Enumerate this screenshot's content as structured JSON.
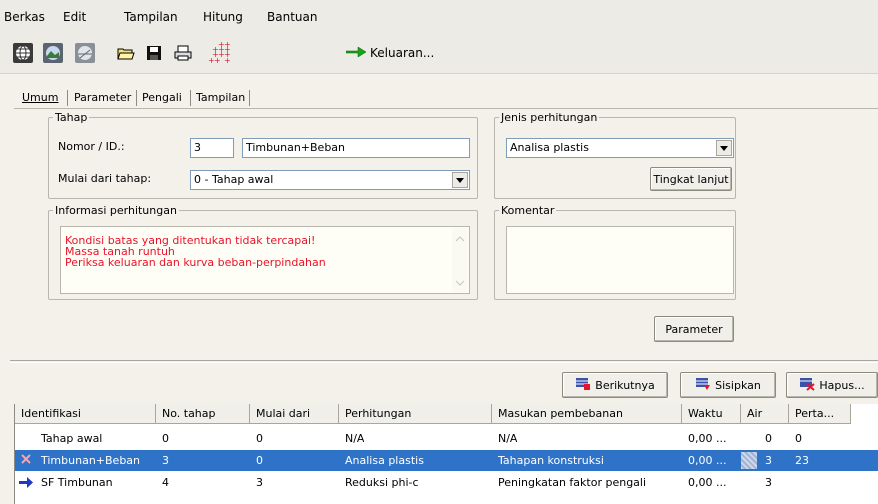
{
  "menu": [
    "Berkas",
    "Edit",
    "Tampilan",
    "Hitung",
    "Bantuan"
  ],
  "toolbar": {
    "icons": [
      "globe-icon",
      "globe-picture-icon",
      "globe-mesh-icon",
      "open-folder-icon",
      "save-icon",
      "print-icon",
      "select-points-icon"
    ],
    "output_label": "Keluaran..."
  },
  "tabs": [
    "Umum",
    "Parameter",
    "Pengali",
    "Tampilan"
  ],
  "tahap": {
    "legend": "Tahap",
    "nomor_label": "Nomor / ID.:",
    "nomor_value": "3",
    "id_value": "Timbunan+Beban",
    "mulai_label": "Mulai dari tahap:",
    "mulai_value": "0 - Tahap awal"
  },
  "jenis": {
    "legend": "Jenis perhitungan",
    "value": "Analisa plastis",
    "advanced_button": "Tingkat lanjut"
  },
  "info": {
    "legend": "Informasi perhitungan",
    "lines": [
      "Kondisi batas yang ditentukan tidak tercapai!",
      "Massa tanah runtuh",
      "Periksa keluaran dan kurva beban-perpindahan"
    ]
  },
  "komentar": {
    "legend": "Komentar",
    "value": ""
  },
  "parameter_button": "Parameter",
  "actions": {
    "next": "Berikutnya",
    "insert": "Sisipkan",
    "delete": "Hapus..."
  },
  "grid": {
    "headers": [
      "Identifikasi",
      "No. tahap",
      "Mulai dari",
      "Perhitungan",
      "Masukan pembebanan",
      "Waktu",
      "Air",
      "Perta..."
    ],
    "rows": [
      {
        "marker": "",
        "cells": [
          "Tahap awal",
          "0",
          "0",
          "N/A",
          "N/A",
          "0,00 ...",
          "0",
          "0"
        ]
      },
      {
        "marker": "x-icon",
        "cells": [
          "Timbunan+Beban",
          "3",
          "0",
          "Analisa plastis",
          "Tahapan konstruksi",
          "0,00 ...",
          "3",
          "23"
        ]
      },
      {
        "marker": "arrow-icon",
        "cells": [
          "SF Timbunan",
          "4",
          "3",
          "Reduksi phi-c",
          "Peningkatan faktor pengali",
          "0,00 ...",
          "3",
          ""
        ]
      }
    ]
  },
  "colors": {
    "selection": "#2f73c9",
    "error_text": "#e8132a",
    "menubar": "#ecebe6"
  }
}
